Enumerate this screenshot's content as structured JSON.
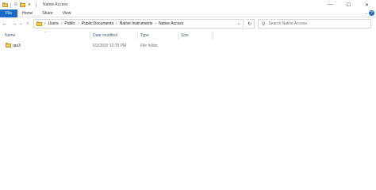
{
  "window": {
    "title": "Native Access",
    "controls": [
      "minimize",
      "maximize",
      "close"
    ]
  },
  "ribbon": {
    "tabs": [
      {
        "label": "File",
        "active": true
      },
      {
        "label": "Home",
        "active": false
      },
      {
        "label": "Share",
        "active": false
      },
      {
        "label": "View",
        "active": false
      }
    ]
  },
  "address": {
    "crumbs": [
      "Users",
      "Public",
      "Public Documents",
      "Native Instruments",
      "Native Access"
    ]
  },
  "search": {
    "placeholder": "Search Native Access"
  },
  "columns": {
    "name": "Name",
    "date_modified": "Date modified",
    "type": "Type",
    "size": "Size"
  },
  "files": [
    {
      "name": "ras3",
      "date_modified": "6/3/2020 12:35 PM",
      "type": "File folder",
      "size": "",
      "icon": "folder-icon"
    }
  ],
  "colors": {
    "accent": "#1b6ac9",
    "folder": "#f2c94c",
    "header_text": "#4c607a"
  }
}
